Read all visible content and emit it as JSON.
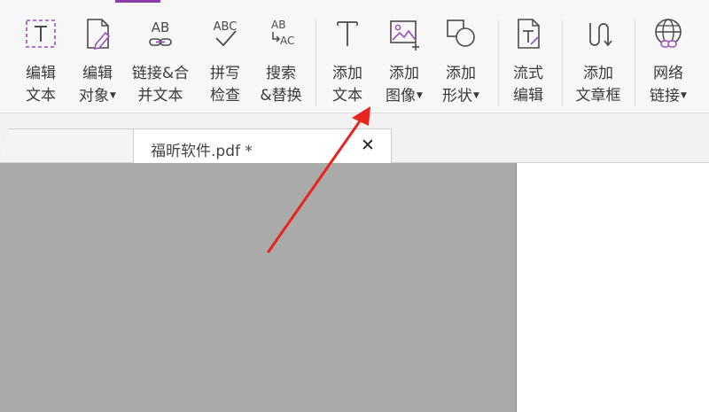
{
  "ribbon": {
    "tools": [
      {
        "id": "edit-text",
        "line1": "编辑",
        "line2": "文本",
        "caret": false
      },
      {
        "id": "edit-object",
        "line1": "编辑",
        "line2": "对象",
        "caret": true
      },
      {
        "id": "link-merge-text",
        "line1": "链接&合",
        "line2": "并文本",
        "caret": false
      },
      {
        "id": "spell-check",
        "line1": "拼写",
        "line2": "检查",
        "caret": false
      },
      {
        "id": "search-replace",
        "line1": "搜索",
        "line2": "&替换",
        "caret": false
      },
      {
        "id": "add-text",
        "line1": "添加",
        "line2": "文本",
        "caret": false
      },
      {
        "id": "add-image",
        "line1": "添加",
        "line2": "图像",
        "caret": true
      },
      {
        "id": "add-shape",
        "line1": "添加",
        "line2": "形状",
        "caret": true
      },
      {
        "id": "flow-edit",
        "line1": "流式",
        "line2": "编辑",
        "caret": false
      },
      {
        "id": "add-article-box",
        "line1": "添加",
        "line2": "文章框",
        "caret": false
      },
      {
        "id": "web-link",
        "line1": "网络",
        "line2": "链接",
        "caret": true
      }
    ],
    "icon_glyphs": {
      "spell_abc": "ABC",
      "link_ab": "AB",
      "search_ab": "AB",
      "search_ac": "AC"
    }
  },
  "document_tab": {
    "title": "福昕软件.pdf *",
    "close_glyph": "✕"
  },
  "colors": {
    "accent_purple": "#8a3ea8",
    "icon_gray": "#4a4a4a",
    "annotation_arrow": "#e8241f",
    "canvas_gray": "#aaaaaa"
  },
  "icons": [
    "text-box-icon",
    "page-pencil-icon",
    "link-ab-icon",
    "spell-check-icon",
    "search-replace-icon",
    "text-t-icon",
    "image-add-icon",
    "shapes-icon",
    "flow-text-icon",
    "article-path-icon",
    "globe-link-icon"
  ]
}
